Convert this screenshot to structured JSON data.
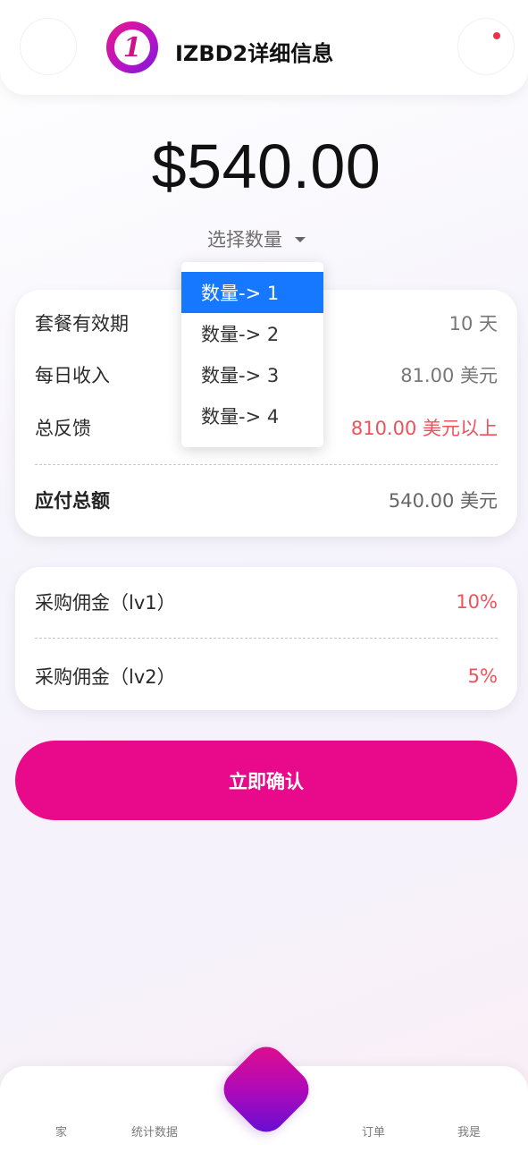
{
  "header": {
    "title": "IZBD2详细信息",
    "logo_glyph": "1",
    "left_icon": "back-icon",
    "right_icon": "notification-icon",
    "notification_dot_color": "#e8334a"
  },
  "price": "$540.00",
  "quantity_select": {
    "label": "选择数量"
  },
  "dropdown": {
    "items": [
      "数量-> 1",
      "数量-> 2",
      "数量-> 3",
      "数量-> 4"
    ],
    "selected": "数量-> 1",
    "selected_color": "#1677ff"
  },
  "details": [
    {
      "label": "套餐有效期",
      "value": "10 天"
    },
    {
      "label": "每日收入",
      "value": "81.00 美元"
    },
    {
      "label": "总反馈",
      "value": "810.00 美元以上"
    }
  ],
  "total": {
    "label": "应付总额",
    "value": "540.00 美元"
  },
  "commissions": [
    {
      "label": "采购佣金（lv1）",
      "value": "10%"
    },
    {
      "label": "采购佣金（lv2）",
      "value": "5%"
    }
  ],
  "confirm_button": {
    "label": "立即确认",
    "color": "#e80a8a"
  },
  "bottom_nav": {
    "items": [
      "家",
      "统计数据",
      "订单",
      "我是"
    ],
    "center_icon": "center-action-icon"
  }
}
